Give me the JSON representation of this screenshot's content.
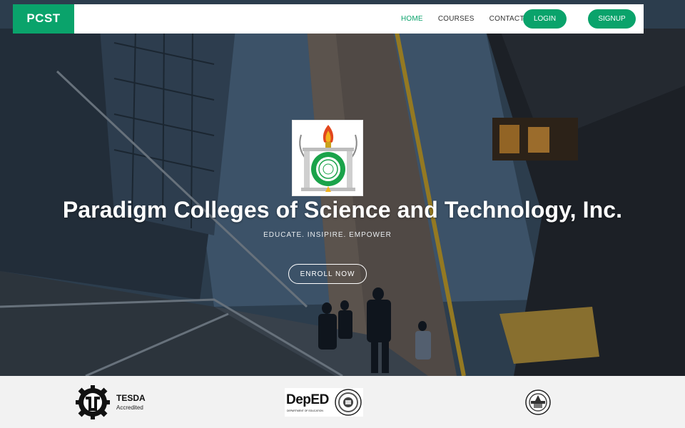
{
  "nav": {
    "brand": "PCST",
    "links": [
      "HOME",
      "COURSES",
      "CONTACT"
    ],
    "login_label": "LOGIN",
    "signup_label": "SIGNUP",
    "accent": "#0aa36b"
  },
  "hero": {
    "title": "Paradigm Colleges of Science and Technology, Inc.",
    "tagline": "EDUCATE. INSIPIRE. EMPOWER",
    "cta_label": "ENROLL NOW"
  },
  "partners": {
    "tesda_name": "TESDA",
    "tesda_sub": "Accredited",
    "deped_word": "DepED",
    "deped_sub": "DEPARTMENT OF EDUCATION"
  }
}
